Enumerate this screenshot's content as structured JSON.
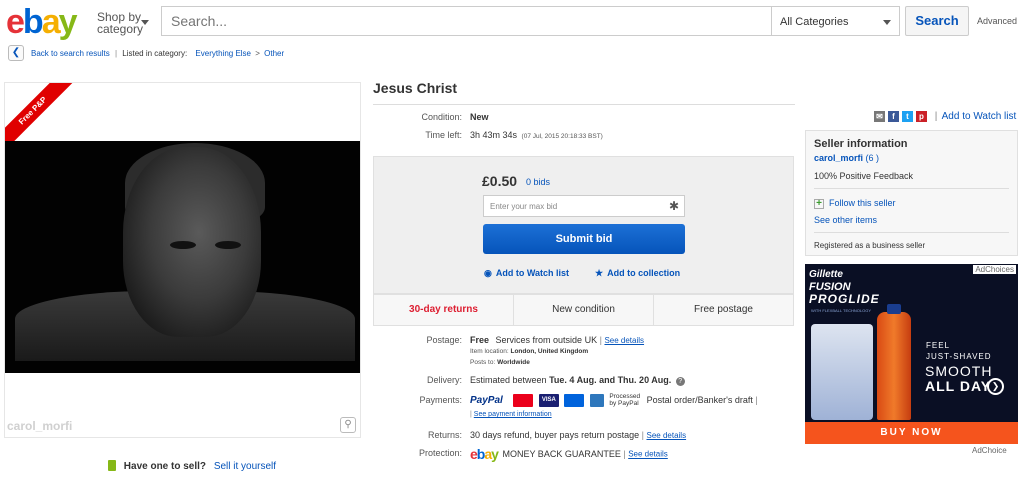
{
  "header": {
    "logo": {
      "e": "e",
      "b": "b",
      "a": "a",
      "y": "y"
    },
    "shop_by": "Shop by",
    "category": "category",
    "search_placeholder": "Search...",
    "category_select": "All Categories",
    "search_button": "Search",
    "advanced": "Advanced"
  },
  "breadcrumb": {
    "back": "Back to search results",
    "listed_in": "Listed in category:",
    "cat1": "Everything Else",
    "arrow": ">",
    "cat2": "Other"
  },
  "image": {
    "ribbon": "Free P&P",
    "watermark": "carol_morfi"
  },
  "sell": {
    "question": "Have one to sell?",
    "link": "Sell it yourself"
  },
  "item": {
    "title": "Jesus Christ",
    "condition_label": "Condition:",
    "condition": "New",
    "time_label": "Time left:",
    "time_left": "3h 43m 34s",
    "time_end": "(07 Jul, 2015   20:18:33 BST)",
    "watch_list_top": "Add to Watch list"
  },
  "bid": {
    "price": "£0.50",
    "bids": "0 bids",
    "placeholder": "Enter your max bid",
    "submit": "Submit bid",
    "add_watch": "Add to Watch list",
    "add_collection": "Add to collection"
  },
  "features": [
    "30-day returns",
    "New condition",
    "Free postage"
  ],
  "postage": {
    "label": "Postage:",
    "value": "Free",
    "services": "Services from outside UK",
    "details": "See details",
    "location_label": "Item location:",
    "location": "London, United Kingdom",
    "posts_label": "Posts to:",
    "posts": "Worldwide"
  },
  "delivery": {
    "label": "Delivery:",
    "prefix": "Estimated between",
    "range": "Tue. 4 Aug. and Thu. 20 Aug."
  },
  "payments": {
    "label": "Payments:",
    "paypal": "PayPal",
    "visa": "VISA",
    "processed": "Processed",
    "by_paypal": "by PayPal",
    "other": "Postal order/Banker's draft",
    "see_info": "See payment information"
  },
  "returns": {
    "label": "Returns:",
    "value": "30 days refund, buyer pays return postage",
    "details": "See details"
  },
  "protection": {
    "label": "Protection:",
    "guarantee": "MONEY BACK GUARANTEE",
    "details": "See details"
  },
  "seller": {
    "heading": "Seller information",
    "name": "carol_morfi",
    "score": "(6 )",
    "feedback": "100% Positive Feedback",
    "follow": "Follow this seller",
    "other_items": "See other items",
    "registered": "Registered as a business seller"
  },
  "ad": {
    "adchoices": "AdChoices",
    "brand": "Gillette",
    "fusion": "FUSION",
    "proglide": "PROGLIDE",
    "tech": "WITH FLEXBALL TECHNOLOGY",
    "feel": "FEEL",
    "just_shaved": "JUST-SHAVED",
    "smooth": "SMOOTH",
    "all_day": "ALL DAY",
    "buy_now": "BUY NOW",
    "adchoice_footer": "AdChoice"
  }
}
